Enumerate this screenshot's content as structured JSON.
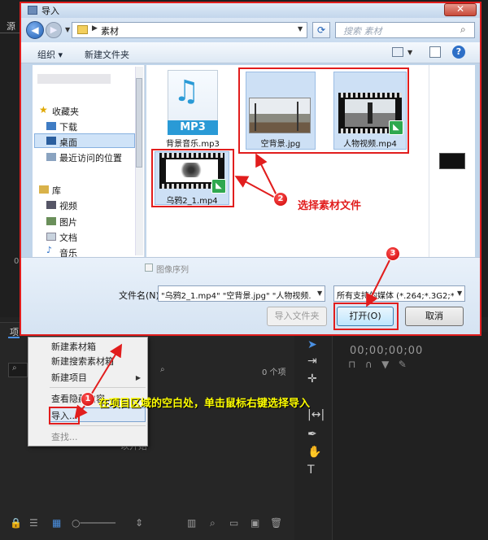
{
  "premiere": {
    "source_tab": "源",
    "source_timecode": "0",
    "project_tab": "项",
    "item_count": "0 个项",
    "start_hint": "以开始",
    "timecode": "00;00;00;00"
  },
  "context_menu": {
    "items": [
      {
        "label": "新建素材箱"
      },
      {
        "label": "新建搜索素材箱"
      },
      {
        "label": "新建项目"
      },
      {
        "label": "查看隐藏内容"
      },
      {
        "label": "导入..."
      },
      {
        "label": "查找..."
      }
    ]
  },
  "dialog": {
    "title": "导入",
    "address": "素材",
    "search_placeholder": "搜索 素材",
    "toolbar": {
      "organize": "组织 ▾",
      "new_folder": "新建文件夹"
    },
    "nav": {
      "favorites": "收藏夹",
      "downloads": "下载",
      "desktop": "桌面",
      "recent": "最近访问的位置",
      "library": "库",
      "videos": "视频",
      "pictures": "图片",
      "documents": "文档",
      "music": "音乐"
    },
    "files": [
      {
        "name": "背景音乐.mp3",
        "badge": "MP3"
      },
      {
        "name": "空背景.jpg"
      },
      {
        "name": "人物视频.mp4"
      },
      {
        "name": "乌鸦2_1.mp4"
      }
    ],
    "image_sequence": "图像序列",
    "filename_label": "文件名(N):",
    "filename_value": "\"乌鸦2_1.mp4\" \"空背景.jpg\" \"人物视频.mp4\"",
    "filetype_value": "所有支持的媒体 (*.264;*.3G2;*",
    "import_folder_btn": "导入文件夹",
    "open_btn": "打开(O)",
    "cancel_btn": "取消"
  },
  "annotations": {
    "step1": {
      "num": "1",
      "text": "在项目区域的空白处，单击鼠标右键选择导入"
    },
    "step2": {
      "num": "2",
      "text": "选择素材文件"
    },
    "step3": {
      "num": "3"
    }
  },
  "colors": {
    "annotation": "#e11d1d",
    "annotation_text": "#ffff00",
    "accent": "#2a9ad6"
  }
}
